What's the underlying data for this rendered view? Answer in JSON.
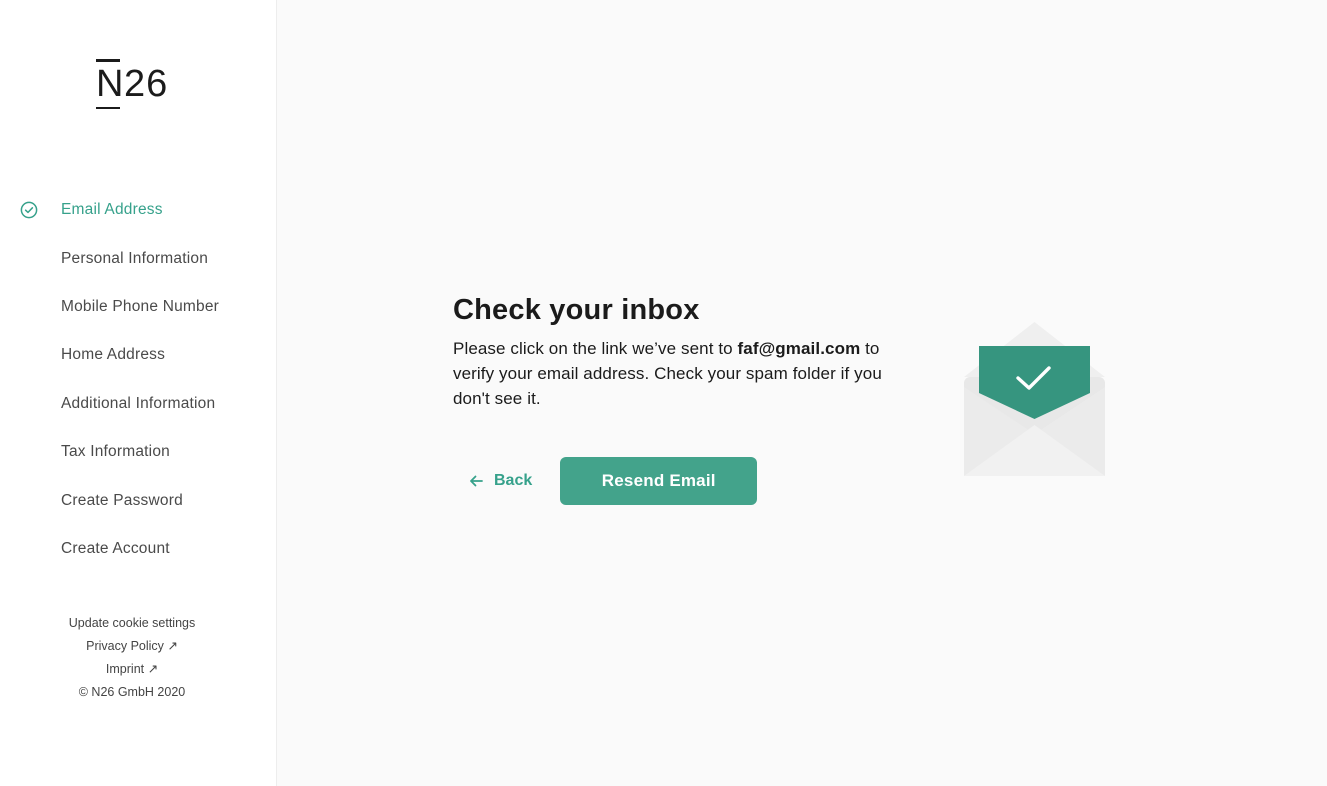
{
  "brand": {
    "logo_text": "N26",
    "accent_color": "#36a18b",
    "button_color": "#43a38b"
  },
  "sidebar": {
    "steps": [
      {
        "label": "Email Address",
        "state": "completed"
      },
      {
        "label": "Personal Information",
        "state": "pending"
      },
      {
        "label": "Mobile Phone Number",
        "state": "pending"
      },
      {
        "label": "Home Address",
        "state": "pending"
      },
      {
        "label": "Additional Information",
        "state": "pending"
      },
      {
        "label": "Tax Information",
        "state": "pending"
      },
      {
        "label": "Create Password",
        "state": "pending"
      },
      {
        "label": "Create Account",
        "state": "pending"
      }
    ],
    "footer": {
      "cookie_settings": "Update cookie settings",
      "privacy_policy": "Privacy Policy ↗",
      "imprint": "Imprint ↗",
      "copyright": "© N26 GmbH 2020"
    }
  },
  "main": {
    "title": "Check your inbox",
    "desc_before": "Please click on the link we’ve sent to ",
    "email": "faf@gmail.com",
    "desc_after": " to verify your email address. Check your spam folder if you don't see it.",
    "back_label": "Back",
    "resend_label": "Resend Email",
    "illustration": "open-envelope-check-icon"
  }
}
